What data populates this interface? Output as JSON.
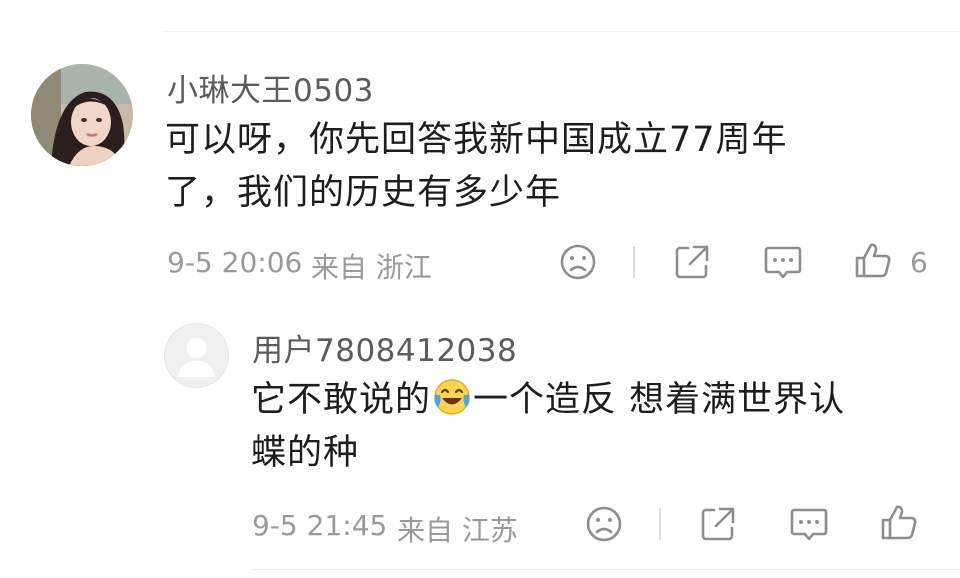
{
  "comments": [
    {
      "username": "小琳大王0503",
      "text_line1": "可以呀，你先回答我新中国成立77周年",
      "text_line2": "了，我们的历史有多少年",
      "time": "9-5 20:06",
      "location": "来自 浙江",
      "like_count": "6"
    }
  ],
  "reply": {
    "username": "用户7808412038",
    "text_line1_a": "它不敢说的",
    "emoji": "laughing-crying-emoji",
    "text_line1_b": "一个造反 想着满世界认",
    "text_line2": "蝶的种",
    "time": "9-5 21:45",
    "location": "来自 江苏"
  },
  "colors": {
    "meta": "#9a9a9a",
    "username": "#5c5c5c",
    "text": "#1e1e1e",
    "divider": "#ececec"
  }
}
